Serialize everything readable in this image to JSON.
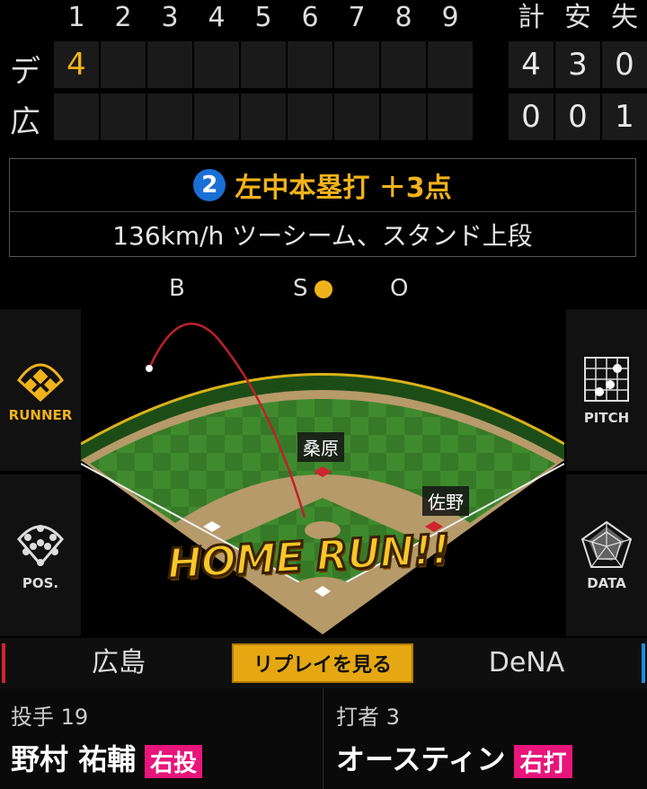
{
  "scoreboard": {
    "innings": [
      "1",
      "2",
      "3",
      "4",
      "5",
      "6",
      "7",
      "8",
      "9"
    ],
    "totals_headers": [
      "計",
      "安",
      "失"
    ],
    "teams": [
      {
        "label": "デ",
        "innings": [
          "4",
          "",
          "",
          "",
          "",
          "",
          "",
          "",
          ""
        ],
        "totals": [
          "4",
          "3",
          "0"
        ]
      },
      {
        "label": "広",
        "innings": [
          "",
          "",
          "",
          "",
          "",
          "",
          "",
          "",
          ""
        ],
        "totals": [
          "0",
          "0",
          "1"
        ]
      }
    ]
  },
  "play": {
    "number": "2",
    "result": "左中本塁打 ＋3点",
    "detail": "136km/h ツーシーム、スタンド上段"
  },
  "count": {
    "b": "B",
    "s": "S",
    "o": "O",
    "strikes_lit": 1
  },
  "side_buttons": {
    "runner": "RUNNER",
    "pitch": "PITCH",
    "pos": "POS.",
    "data": "DATA"
  },
  "field": {
    "fielders": [
      {
        "name": "桑原"
      },
      {
        "name": "佐野"
      }
    ],
    "banner": "HOME RUN!!"
  },
  "teams": {
    "home": "広島",
    "away": "DeNA",
    "replay": "リプレイを見る"
  },
  "pitcher": {
    "role": "投手 19",
    "name": "野村 祐輔",
    "hand": "右投"
  },
  "batter": {
    "role": "打者 3",
    "name": "オースティン",
    "hand": "右打"
  },
  "colors": {
    "accent": "#f0b21a",
    "badge": "#1a6fd6",
    "hand": "#e8157a",
    "home_bar": "#d0242f",
    "away_bar": "#1a8ee0"
  }
}
